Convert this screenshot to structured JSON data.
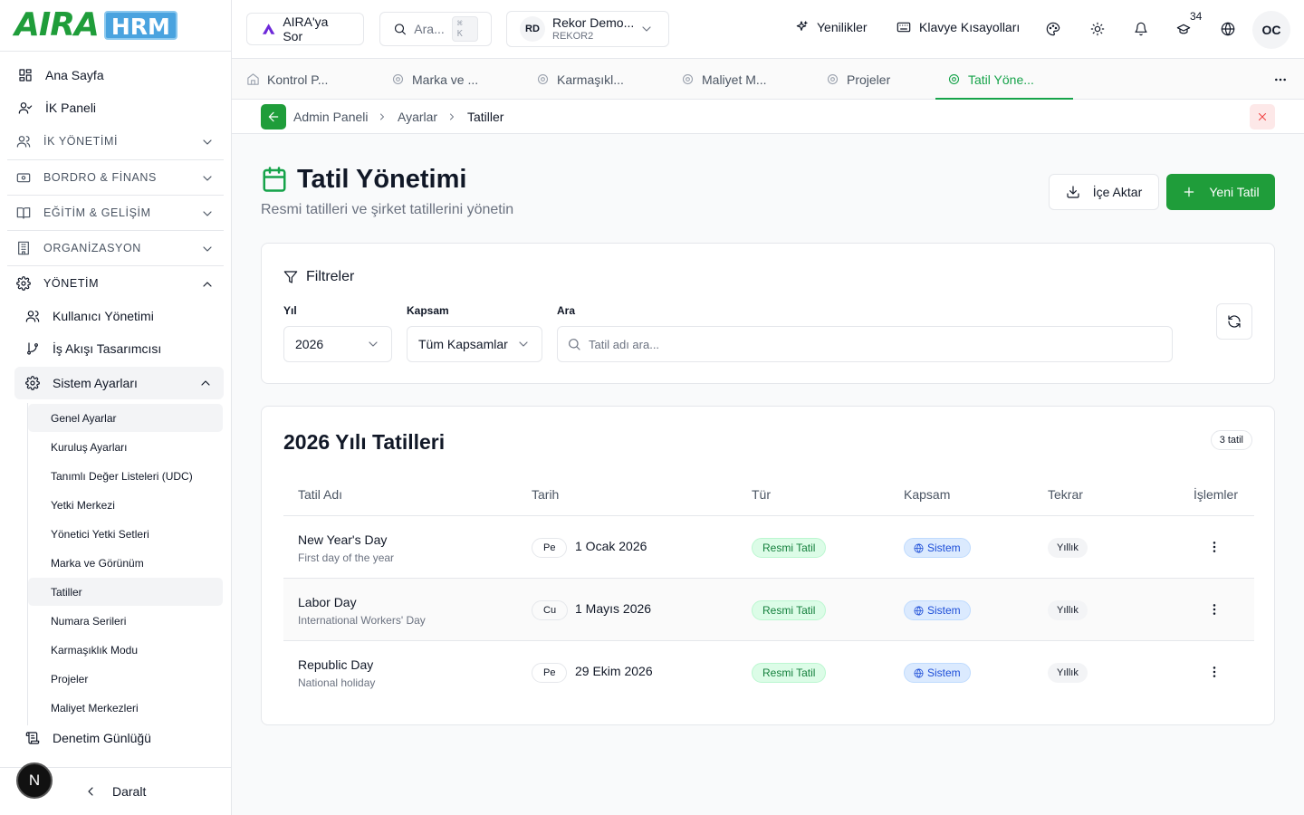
{
  "logo": {
    "word": "AIRA",
    "product": "HRM"
  },
  "sidebar": {
    "home": "Ana Sayfa",
    "hr_panel": "İK Paneli",
    "sections": [
      {
        "label": "İK YÖNETİMİ"
      },
      {
        "label": "BORDRO & FİNANS"
      },
      {
        "label": "EĞİTİM & GELİŞİM"
      },
      {
        "label": "ORGANİZASYON"
      },
      {
        "label": "YÖNETİM"
      }
    ],
    "management": {
      "users": "Kullanıcı Yönetimi",
      "workflow": "İş Akışı Tasarımcısı",
      "system_settings": "Sistem Ayarları",
      "settings_items": [
        "Genel Ayarlar",
        "Kuruluş Ayarları",
        "Tanımlı Değer Listeleri (UDC)",
        "Yetki Merkezi",
        "Yönetici Yetki Setleri",
        "Marka ve Görünüm",
        "Tatiller",
        "Numara Serileri",
        "Karmaşıklık Modu",
        "Projeler",
        "Maliyet Merkezleri"
      ],
      "audit_log": "Denetim Günlüğü"
    },
    "footer": {
      "badge": "N",
      "collapse": "Daralt"
    }
  },
  "topbar": {
    "ask_aira": "AIRA'ya Sor",
    "search_placeholder": "Ara...",
    "search_shortcut": "⌘ K",
    "company_initials": "RD",
    "company_name": "Rekor Demo...",
    "company_code": "REKOR2",
    "whats_new": "Yenilikler",
    "shortcuts": "Klavye Kısayolları",
    "learning_count": "34",
    "user_initials": "OC"
  },
  "tabs": [
    {
      "label": "Kontrol P..."
    },
    {
      "label": "Marka ve ..."
    },
    {
      "label": "Karmaşıkl..."
    },
    {
      "label": "Maliyet M..."
    },
    {
      "label": "Projeler"
    },
    {
      "label": "Tatil Yöne..."
    }
  ],
  "breadcrumb": [
    "Admin Paneli",
    "Ayarlar",
    "Tatiller"
  ],
  "page": {
    "title": "Tatil Yönetimi",
    "subtitle": "Resmi tatilleri ve şirket tatillerini yönetin",
    "import_label": "İçe Aktar",
    "new_label": "Yeni Tatil"
  },
  "filters": {
    "heading": "Filtreler",
    "year_label": "Yıl",
    "year_value": "2026",
    "scope_label": "Kapsam",
    "scope_value": "Tüm Kapsamlar",
    "search_label": "Ara",
    "search_placeholder": "Tatil adı ara..."
  },
  "table": {
    "title": "2026 Yılı Tatilleri",
    "count": "3 tatil",
    "columns": [
      "Tatil Adı",
      "Tarih",
      "Tür",
      "Kapsam",
      "Tekrar",
      "İşlemler"
    ],
    "rows": [
      {
        "name": "New Year's Day",
        "desc": "First day of the year",
        "day": "Pe",
        "date": "1 Ocak 2026",
        "type": "Resmi Tatil",
        "scope": "Sistem",
        "repeat": "Yıllık"
      },
      {
        "name": "Labor Day",
        "desc": "International Workers' Day",
        "day": "Cu",
        "date": "1 Mayıs 2026",
        "type": "Resmi Tatil",
        "scope": "Sistem",
        "repeat": "Yıllık"
      },
      {
        "name": "Republic Day",
        "desc": "National holiday",
        "day": "Pe",
        "date": "29 Ekim 2026",
        "type": "Resmi Tatil",
        "scope": "Sistem",
        "repeat": "Yıllık"
      }
    ]
  },
  "colors": {
    "brand_green": "#1f9d3a",
    "hrm_blue": "#4aa3df",
    "danger": "#ef4444"
  }
}
